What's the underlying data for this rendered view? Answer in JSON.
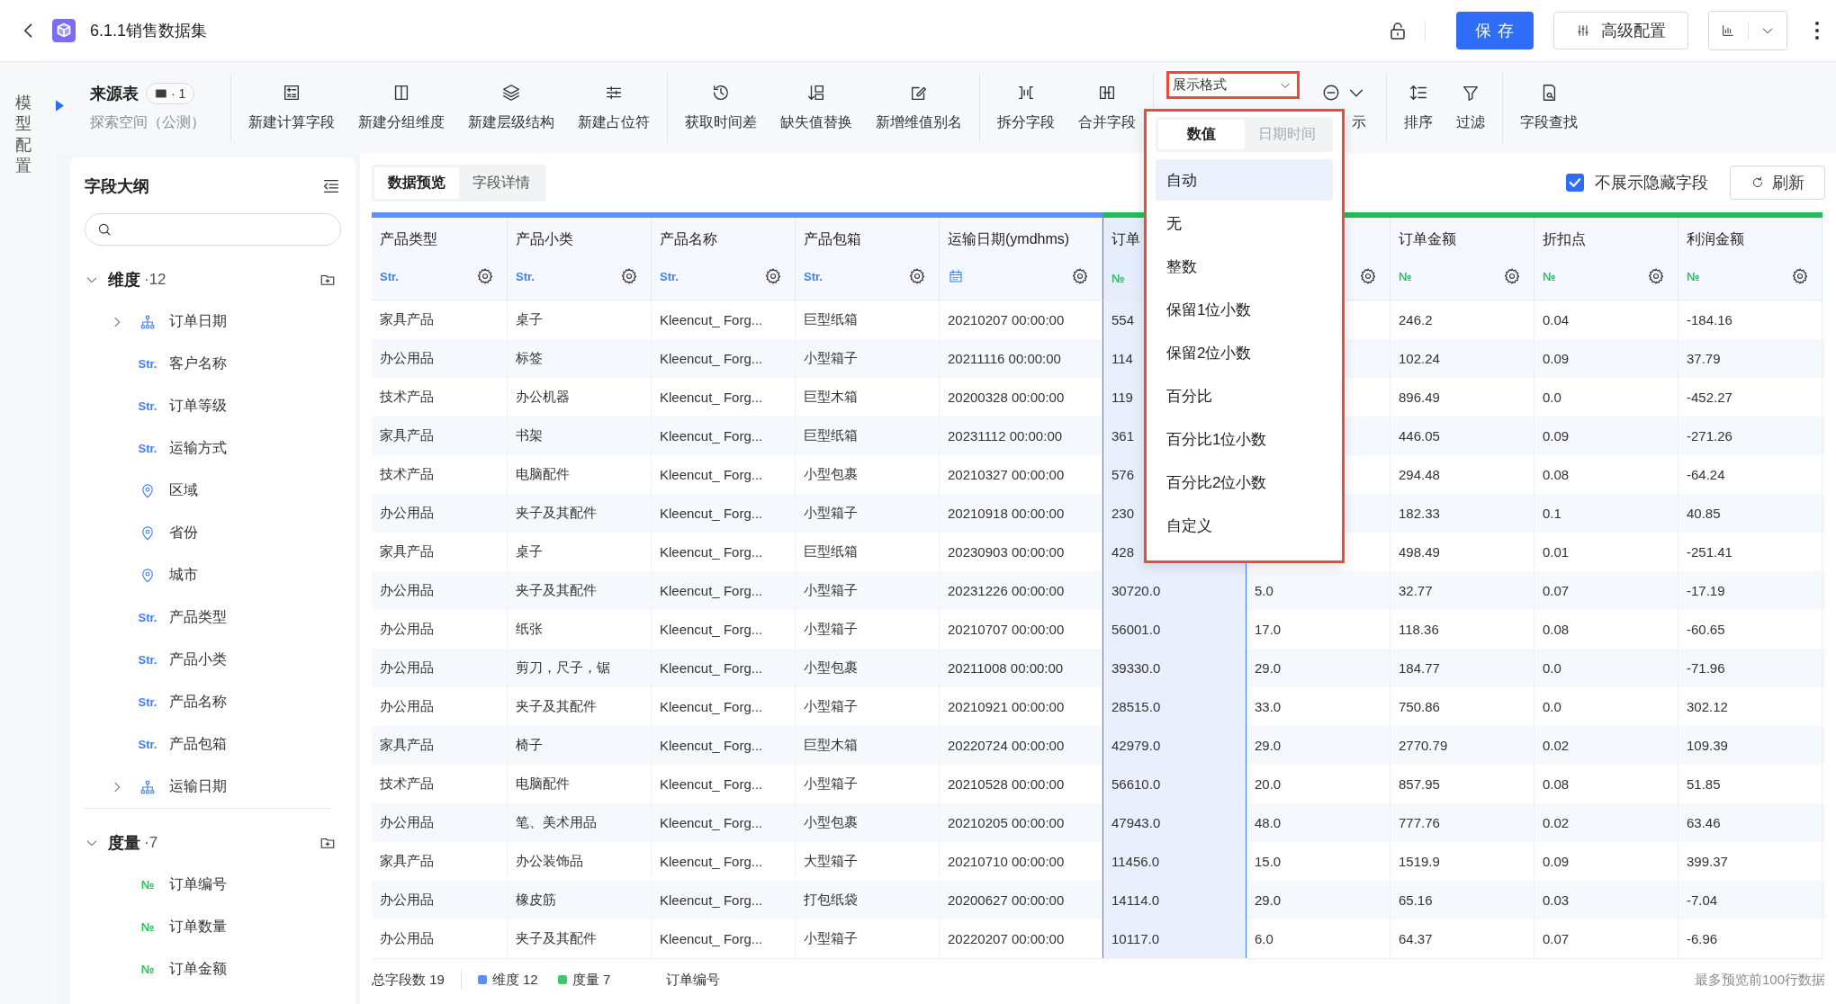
{
  "header": {
    "title": "6.1.1销售数据集",
    "save_button": "保 存",
    "config_button": "高级配置"
  },
  "side_rail": {
    "label": "模型配置"
  },
  "toolbar": {
    "source": {
      "title": "来源表",
      "badge": "· 1",
      "subtitle": "探索空间（公测）"
    },
    "groups": [
      [
        {
          "kind": "button",
          "label": "新建计算字段"
        },
        {
          "kind": "button",
          "label": "新建分组维度"
        },
        {
          "kind": "button",
          "label": "新建层级结构"
        },
        {
          "kind": "button",
          "label": "新建占位符"
        }
      ],
      [
        {
          "kind": "button",
          "label": "获取时间差"
        },
        {
          "kind": "button",
          "label": "缺失值替换"
        },
        {
          "kind": "button",
          "label": "新增维值别名"
        }
      ],
      [
        {
          "kind": "button",
          "label": "拆分字段"
        },
        {
          "kind": "button",
          "label": "合并字段"
        }
      ],
      [
        {
          "kind": "select",
          "value": "展示格式",
          "highlighted": true
        },
        {
          "kind": "menu",
          "label": "示"
        }
      ],
      [
        {
          "kind": "button",
          "label": "排序"
        },
        {
          "kind": "button",
          "label": "过滤"
        }
      ],
      [
        {
          "kind": "button",
          "label": "字段查找"
        }
      ]
    ]
  },
  "format_dropdown": {
    "highlighted": true,
    "tabs": [
      {
        "label": "数值",
        "selected": true
      },
      {
        "label": "日期时间",
        "selected": false
      }
    ],
    "options": [
      {
        "label": "自动",
        "selected": true
      },
      {
        "label": "无",
        "selected": false
      },
      {
        "label": "整数",
        "selected": false
      },
      {
        "label": "保留1位小数",
        "selected": false
      },
      {
        "label": "保留2位小数",
        "selected": false
      },
      {
        "label": "百分比",
        "selected": false
      },
      {
        "label": "百分比1位小数",
        "selected": false
      },
      {
        "label": "百分比2位小数",
        "selected": false
      },
      {
        "label": "自定义",
        "selected": false
      }
    ]
  },
  "outline": {
    "title": "字段大纲",
    "groups": [
      {
        "label": "维度",
        "count": "·12",
        "expanded": true,
        "children": [
          {
            "label": "订单日期",
            "kind": "hierarchy",
            "expanded": false
          },
          {
            "label": "客户名称",
            "kind": "string",
            "type_label": "Str."
          },
          {
            "label": "订单等级",
            "kind": "string",
            "type_label": "Str."
          },
          {
            "label": "运输方式",
            "kind": "string",
            "type_label": "Str."
          },
          {
            "label": "区域",
            "kind": "geo"
          },
          {
            "label": "省份",
            "kind": "geo"
          },
          {
            "label": "城市",
            "kind": "geo"
          },
          {
            "label": "产品类型",
            "kind": "string",
            "type_label": "Str."
          },
          {
            "label": "产品小类",
            "kind": "string",
            "type_label": "Str."
          },
          {
            "label": "产品名称",
            "kind": "string",
            "type_label": "Str."
          },
          {
            "label": "产品包箱",
            "kind": "string",
            "type_label": "Str."
          },
          {
            "label": "运输日期",
            "kind": "hierarchy",
            "expanded": false
          }
        ]
      },
      {
        "label": "度量",
        "count": "·7",
        "expanded": true,
        "children": [
          {
            "label": "订单编号",
            "kind": "number",
            "type_label": "№"
          },
          {
            "label": "订单数量",
            "kind": "number",
            "type_label": "№"
          },
          {
            "label": "订单金额",
            "kind": "number",
            "type_label": "№"
          }
        ]
      }
    ]
  },
  "preview": {
    "tabs": [
      {
        "label": "数据预览",
        "selected": true
      },
      {
        "label": "字段详情",
        "selected": false
      }
    ],
    "hide_hidden_fields": {
      "label": "不展示隐藏字段",
      "checked": true
    },
    "refresh_button": "刷新"
  },
  "table": {
    "columns": [
      {
        "name": "产品类型",
        "kind": "string",
        "type_label": "Str.",
        "selected": false
      },
      {
        "name": "产品小类",
        "kind": "string",
        "type_label": "Str.",
        "selected": false
      },
      {
        "name": "产品名称",
        "kind": "string",
        "type_label": "Str.",
        "selected": false
      },
      {
        "name": "产品包箱",
        "kind": "string",
        "type_label": "Str.",
        "selected": false
      },
      {
        "name": "运输日期(ymdhms)",
        "kind": "date",
        "selected": false
      },
      {
        "name": "订单",
        "kind": "number",
        "type_label": "№",
        "selected": true,
        "settings_icon": false
      },
      {
        "kind": "number",
        "selected": false
      },
      {
        "name": "订单金额",
        "kind": "number",
        "type_label": "№",
        "selected": false
      },
      {
        "name": "折扣点",
        "kind": "number",
        "type_label": "№",
        "selected": false
      },
      {
        "name": "利润金额",
        "kind": "number",
        "type_label": "№",
        "selected": false
      }
    ],
    "rows": [
      [
        "家具产品",
        "桌子",
        "Kleencut_ Forg...",
        "巨型纸箱",
        "20210207 00:00:00",
        "554",
        null,
        "246.2",
        "0.04",
        "-184.16"
      ],
      [
        "办公用品",
        "标签",
        "Kleencut_ Forg...",
        "小型箱子",
        "20211116 00:00:00",
        "114",
        null,
        "102.24",
        "0.09",
        "37.79"
      ],
      [
        "技术产品",
        "办公机器",
        "Kleencut_ Forg...",
        "巨型木箱",
        "20200328 00:00:00",
        "119",
        null,
        "896.49",
        "0.0",
        "-452.27"
      ],
      [
        "家具产品",
        "书架",
        "Kleencut_ Forg...",
        "巨型纸箱",
        "20231112 00:00:00",
        "361",
        null,
        "446.05",
        "0.09",
        "-271.26"
      ],
      [
        "技术产品",
        "电脑配件",
        "Kleencut_ Forg...",
        "小型包裹",
        "20210327 00:00:00",
        "576",
        null,
        "294.48",
        "0.08",
        "-64.24"
      ],
      [
        "办公用品",
        "夹子及其配件",
        "Kleencut_ Forg...",
        "小型箱子",
        "20210918 00:00:00",
        "230",
        null,
        "182.33",
        "0.1",
        "40.85"
      ],
      [
        "家具产品",
        "桌子",
        "Kleencut_ Forg...",
        "巨型纸箱",
        "20230903 00:00:00",
        "428",
        null,
        "498.49",
        "0.01",
        "-251.41"
      ],
      [
        "办公用品",
        "夹子及其配件",
        "Kleencut_ Forg...",
        "小型箱子",
        "20231226 00:00:00",
        "30720.0",
        "5.0",
        "32.77",
        "0.07",
        "-17.19"
      ],
      [
        "办公用品",
        "纸张",
        "Kleencut_ Forg...",
        "小型箱子",
        "20210707 00:00:00",
        "56001.0",
        "17.0",
        "118.36",
        "0.08",
        "-60.65"
      ],
      [
        "办公用品",
        "剪刀，尺子，锯",
        "Kleencut_ Forg...",
        "小型包裹",
        "20211008 00:00:00",
        "39330.0",
        "29.0",
        "184.77",
        "0.0",
        "-71.96"
      ],
      [
        "办公用品",
        "夹子及其配件",
        "Kleencut_ Forg...",
        "小型箱子",
        "20210921 00:00:00",
        "28515.0",
        "33.0",
        "750.86",
        "0.0",
        "302.12"
      ],
      [
        "家具产品",
        "椅子",
        "Kleencut_ Forg...",
        "巨型木箱",
        "20220724 00:00:00",
        "42979.0",
        "29.0",
        "2770.79",
        "0.02",
        "109.39"
      ],
      [
        "技术产品",
        "电脑配件",
        "Kleencut_ Forg...",
        "小型箱子",
        "20210528 00:00:00",
        "56610.0",
        "20.0",
        "857.95",
        "0.08",
        "51.85"
      ],
      [
        "办公用品",
        "笔、美术用品",
        "Kleencut_ Forg...",
        "小型包裹",
        "20210205 00:00:00",
        "47943.0",
        "48.0",
        "777.76",
        "0.02",
        "63.46"
      ],
      [
        "家具产品",
        "办公装饰品",
        "Kleencut_ Forg...",
        "大型箱子",
        "20210710 00:00:00",
        "11456.0",
        "15.0",
        "1519.9",
        "0.09",
        "399.37"
      ],
      [
        "办公用品",
        "橡皮筋",
        "Kleencut_ Forg...",
        "打包纸袋",
        "20200627 00:00:00",
        "14114.0",
        "29.0",
        "65.16",
        "0.03",
        "-7.04"
      ],
      [
        "办公用品",
        "夹子及其配件",
        "Kleencut_ Forg...",
        "小型箱子",
        "20220207 00:00:00",
        "10117.0",
        "6.0",
        "64.37",
        "0.07",
        "-6.96"
      ]
    ]
  },
  "footer": {
    "total_label": "总字段数",
    "total": "19",
    "legend": [
      {
        "label": "维度",
        "count": "12",
        "color": "#5b8ff9"
      },
      {
        "label": "度量",
        "count": "7",
        "color": "#3ccb6c"
      }
    ],
    "selected_field": "订单编号",
    "note": "最多预览前100行数据"
  }
}
